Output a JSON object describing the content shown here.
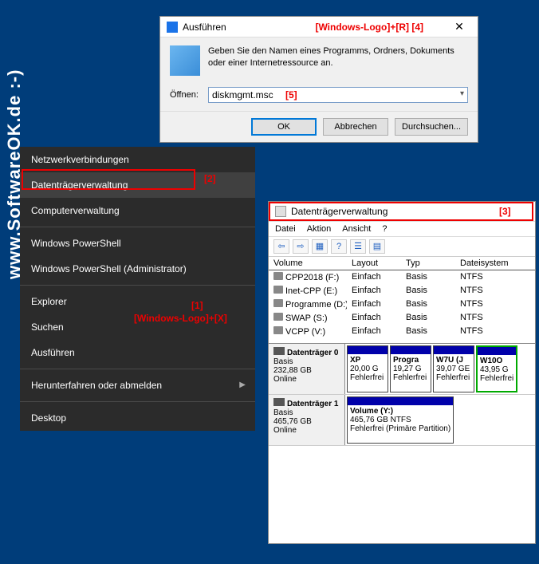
{
  "watermark": "www.SoftwareOK.de :-)",
  "run_dialog": {
    "title": "Ausführen",
    "description": "Geben Sie den Namen eines Programms, Ordners, Dokuments oder einer Internetressource an.",
    "open_label": "Öffnen:",
    "input_value": "diskmgmt.msc",
    "buttons": {
      "ok": "OK",
      "cancel": "Abbrechen",
      "browse": "Durchsuchen..."
    }
  },
  "context_menu": {
    "items": [
      "Netzwerkverbindungen",
      "Datenträgerverwaltung",
      "Computerverwaltung",
      "Windows PowerShell",
      "Windows PowerShell (Administrator)",
      "Explorer",
      "Suchen",
      "Ausführen",
      "Herunterfahren oder abmelden",
      "Desktop"
    ]
  },
  "disk_mgmt": {
    "title": "Datenträgerverwaltung",
    "menu": [
      "Datei",
      "Aktion",
      "Ansicht",
      "?"
    ],
    "columns": [
      "Volume",
      "Layout",
      "Typ",
      "Dateisystem"
    ],
    "volumes": [
      {
        "name": "CPP2018 (F:)",
        "layout": "Einfach",
        "type": "Basis",
        "fs": "NTFS"
      },
      {
        "name": "Inet-CPP (E:)",
        "layout": "Einfach",
        "type": "Basis",
        "fs": "NTFS"
      },
      {
        "name": "Programme (D:)",
        "layout": "Einfach",
        "type": "Basis",
        "fs": "NTFS"
      },
      {
        "name": "SWAP (S:)",
        "layout": "Einfach",
        "type": "Basis",
        "fs": "NTFS"
      },
      {
        "name": "VCPP (V:)",
        "layout": "Einfach",
        "type": "Basis",
        "fs": "NTFS"
      }
    ],
    "disks": [
      {
        "name": "Datenträger 0",
        "type": "Basis",
        "size": "232,88 GB",
        "status": "Online",
        "partitions": [
          {
            "name": "XP",
            "size": "20,00 G",
            "status": "Fehlerfrei"
          },
          {
            "name": "Progra",
            "size": "19,27 G",
            "status": "Fehlerfrei"
          },
          {
            "name": "W7U (J",
            "size": "39,07 GE",
            "status": "Fehlerfrei"
          },
          {
            "name": "W10O",
            "size": "43,95 G",
            "status": "Fehlerfrei",
            "hl": true
          }
        ]
      },
      {
        "name": "Datenträger 1",
        "type": "Basis",
        "size": "465,76 GB",
        "status": "Online",
        "partitions": [
          {
            "name": "Volume  (Y:)",
            "size": "465,76 GB NTFS",
            "status": "Fehlerfrei (Primäre Partition)"
          }
        ]
      }
    ]
  },
  "annotations": {
    "a1_text": "[1]",
    "a1_sub": "[Windows-Logo]+[X]",
    "a2": "[2]",
    "a3": "[3]",
    "a4": "[Windows-Logo]+[R]  [4]",
    "a5": "[5]"
  }
}
